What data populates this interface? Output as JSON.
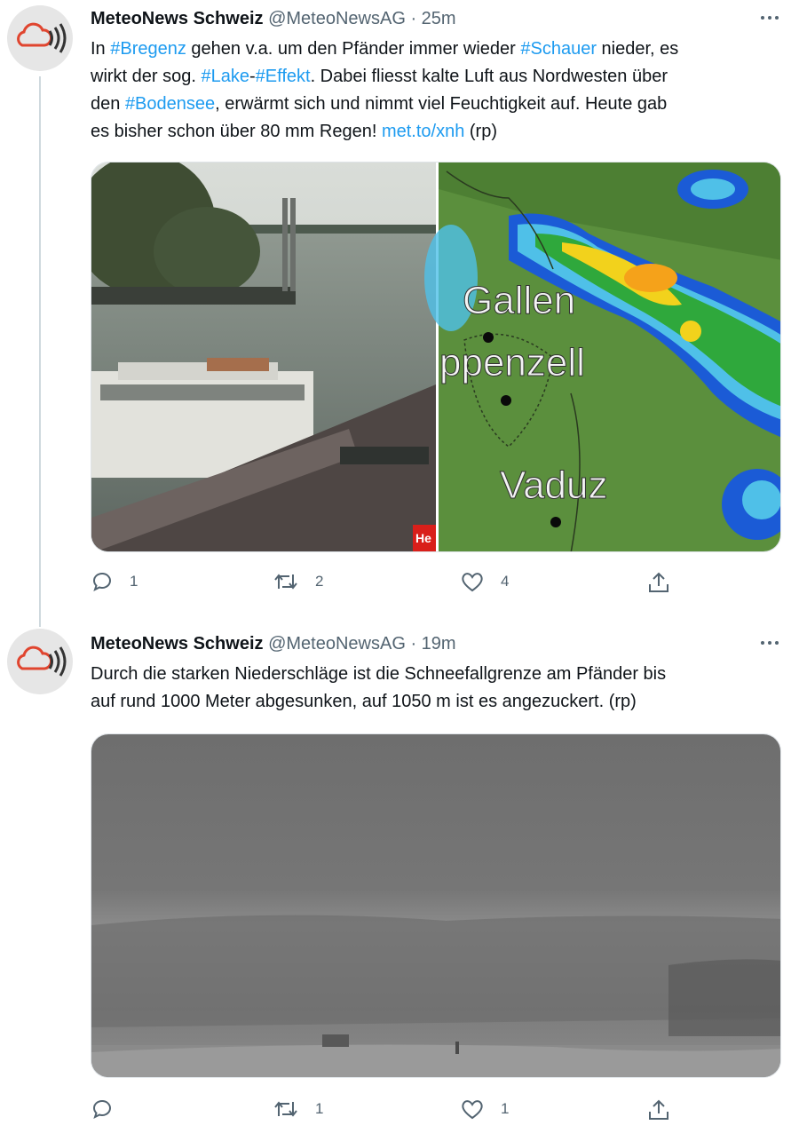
{
  "tweets": [
    {
      "name": "MeteoNews Schweiz",
      "handle": "@MeteoNewsAG",
      "time": "25m",
      "text": [
        [
          "In ",
          "#Bregenz",
          " gehen v.a. um den Pfänder immer wieder ",
          "#Schauer",
          " nieder, es"
        ],
        [
          "wirkt der sog. ",
          "#Lake",
          "-",
          "#Effekt",
          ". Dabei fliesst kalte Luft aus Nordwesten über"
        ],
        [
          "den ",
          "#Bodensee",
          ", erwärmt sich und nimmt viel Feuchtigkeit auf. Heute gab"
        ],
        [
          "es bisher schon über 80 mm Regen! ",
          "met.to/xnh",
          " (rp)"
        ]
      ],
      "map_labels": [
        "Gallen",
        "ppenzell",
        "Vaduz"
      ],
      "image_badge": "He",
      "replies": "1",
      "retweets": "2",
      "likes": "4"
    },
    {
      "name": "MeteoNews Schweiz",
      "handle": "@MeteoNewsAG",
      "time": "19m",
      "text_lines": [
        "Durch die starken Niederschläge ist die Schneefallgrenze am Pfänder bis",
        "auf rund 1000 Meter abgesunken, auf 1050 m ist es angezuckert. (rp)"
      ],
      "replies": "",
      "retweets": "1",
      "likes": "1"
    }
  ],
  "icons": {
    "avatar": "cloud-broadcast-icon",
    "reply": "speech-bubble-icon",
    "retweet": "retweet-arrows-icon",
    "like": "heart-icon",
    "share": "share-upload-icon",
    "more": "ellipsis-icon"
  },
  "colors": {
    "link": "#1d9bf0",
    "muted": "#536471",
    "avatar_cloud": "#e0452f"
  }
}
